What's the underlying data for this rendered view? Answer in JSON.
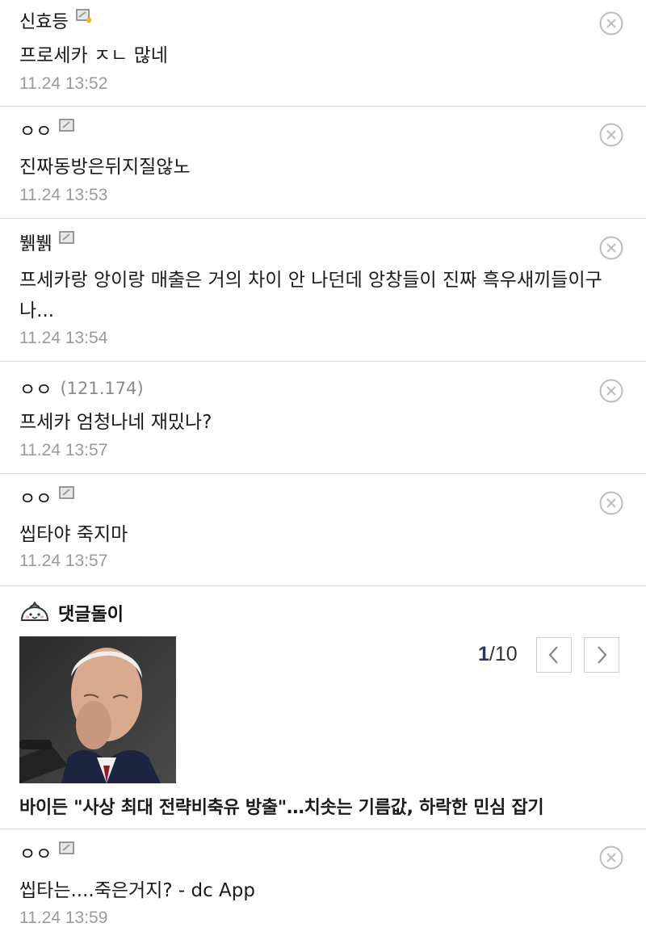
{
  "comments": [
    {
      "nick": "신효등",
      "ip": "",
      "text": "프로세카 ㅈㄴ 많네",
      "date": "11.24 13:52"
    },
    {
      "nick": "ㅇㅇ",
      "ip": "",
      "text": "진짜동방은뒤지질않노",
      "date": "11.24 13:53"
    },
    {
      "nick": "뷁뷁",
      "ip": "",
      "text": "프세카랑 앙이랑 매출은 거의 차이 안 나던데 앙창들이 진짜 흑우새끼들이구나...",
      "date": "11.24 13:54"
    },
    {
      "nick": "ㅇㅇ",
      "ip": "(121.174)",
      "text": "프세카 엄청나네 재밌나?",
      "date": "11.24 13:57"
    },
    {
      "nick": "ㅇㅇ",
      "ip": "",
      "text": "씹타야 죽지마",
      "date": "11.24 13:57"
    },
    {
      "nick": "ㅇㅇ",
      "ip": "",
      "text": "씹타는....죽은거지? - dc App",
      "date": "11.24 13:59"
    }
  ],
  "bot": {
    "title": "댓글돌이",
    "page_current": "1",
    "page_total": "/10",
    "headline": "바이든 \"사상 최대 전략비축유 방출\"…치솟는 기름값, 하락한 민심 잡기"
  },
  "colors": {
    "accent_page": "#2a3566",
    "date": "#9a9a9a",
    "divider": "#d8d8d8"
  },
  "icons": [
    "gallery-member-icon",
    "delete-circle-x-icon",
    "dumpling-mascot-icon",
    "chevron-left-icon",
    "chevron-right-icon"
  ]
}
